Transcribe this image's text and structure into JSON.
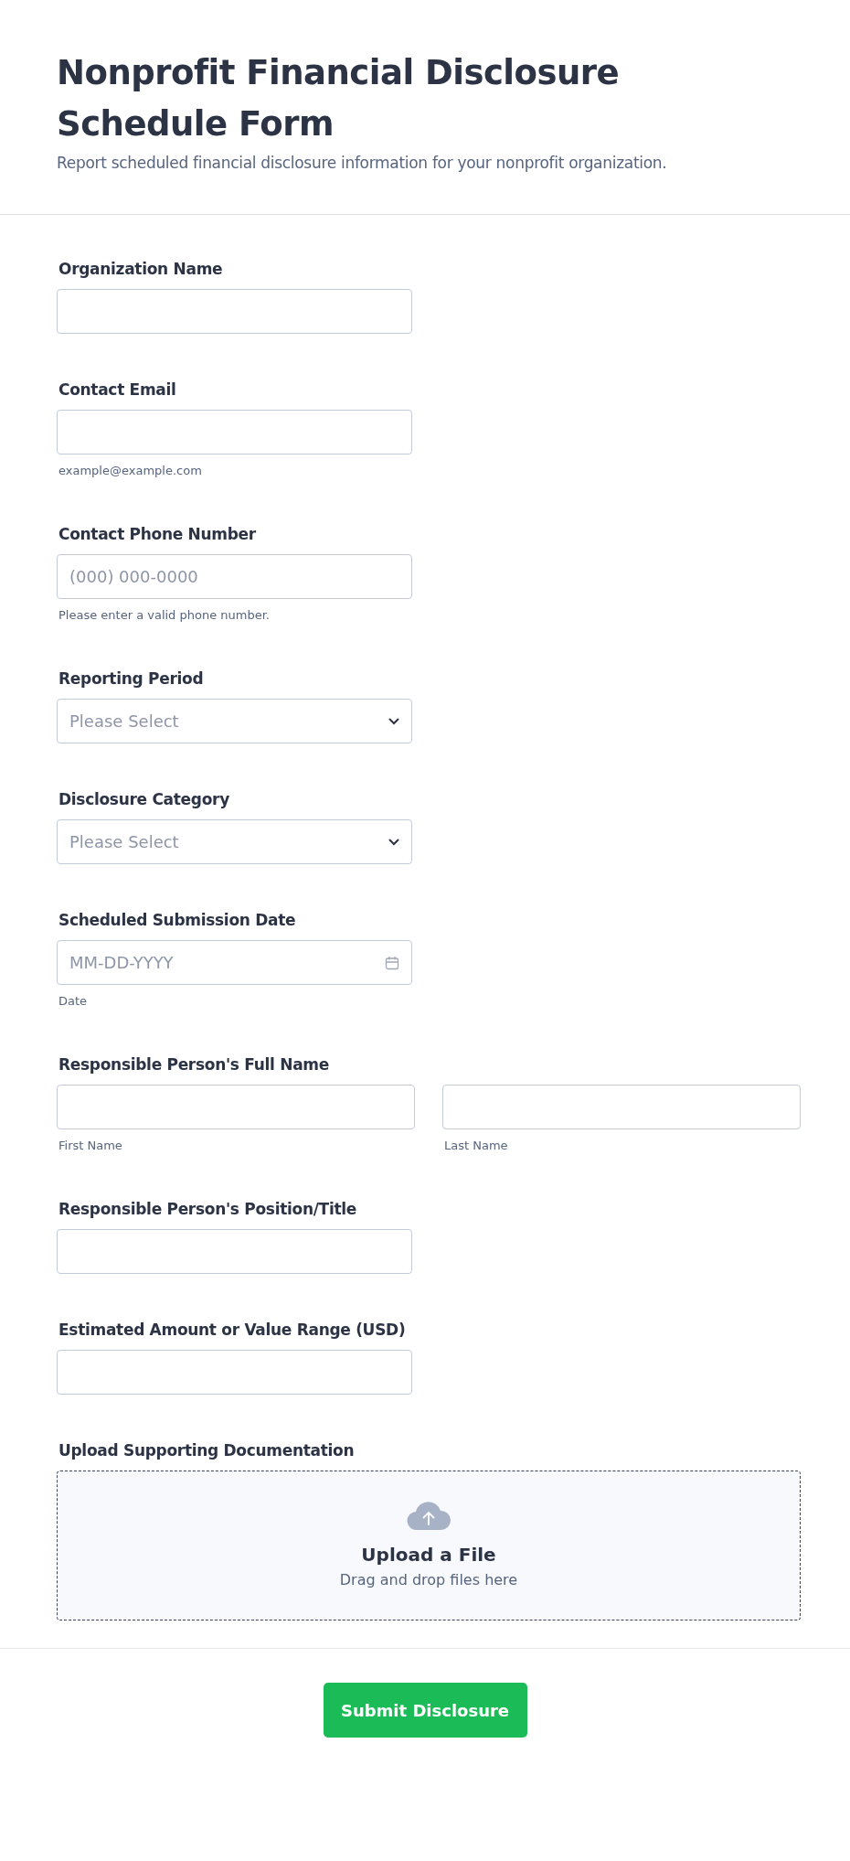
{
  "header": {
    "title": "Nonprofit Financial Disclosure Schedule Form",
    "subtitle": "Report scheduled financial disclosure information for your nonprofit organization."
  },
  "fields": [
    {
      "kind": "text",
      "label": "Organization Name"
    },
    {
      "kind": "text",
      "label": "Contact Email",
      "sublabel": "example@example.com"
    },
    {
      "kind": "text",
      "label": "Contact Phone Number",
      "placeholder": "(000) 000-0000",
      "sublabel": "Please enter a valid phone number."
    },
    {
      "kind": "select",
      "label": "Reporting Period",
      "placeholder": "Please Select"
    },
    {
      "kind": "select",
      "label": "Disclosure Category",
      "placeholder": "Please Select"
    },
    {
      "kind": "date",
      "label": "Scheduled Submission Date",
      "placeholder": "MM-DD-YYYY",
      "sublabel": "Date"
    },
    {
      "kind": "name",
      "label": "Responsible Person's Full Name",
      "parts": [
        {
          "sublabel": "First Name"
        },
        {
          "sublabel": "Last Name"
        }
      ]
    },
    {
      "kind": "text",
      "label": "Responsible Person's Position/Title"
    },
    {
      "kind": "text",
      "label": "Estimated Amount or Value Range (USD)"
    },
    {
      "kind": "upload",
      "label": "Upload Supporting Documentation",
      "button": "Upload a File",
      "hint": "Drag and drop files here"
    }
  ],
  "submit": "Submit Disclosure"
}
